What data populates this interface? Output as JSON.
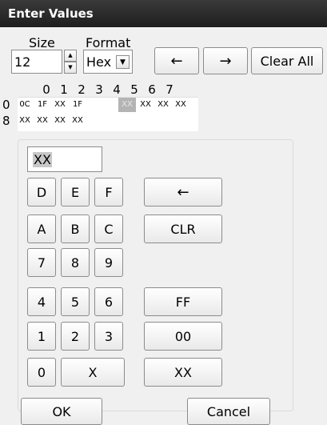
{
  "window": {
    "title": "Enter Values"
  },
  "controls": {
    "size_label": "Size",
    "size_value": "12",
    "format_label": "Format",
    "format_value": "Hex",
    "left_arrow": "←",
    "right_arrow": "→",
    "clear_all": "Clear All"
  },
  "grid": {
    "col_headers": [
      "0",
      "1",
      "2",
      "3",
      "4",
      "5",
      "6",
      "7"
    ],
    "row_headers": [
      "0",
      "8"
    ],
    "row0": [
      "0C",
      "1F",
      "XX",
      "1F",
      "XX",
      "XX",
      "XX",
      "XX"
    ],
    "row1": [
      "XX",
      "XX",
      "XX",
      "XX"
    ],
    "selected_cell": "row0.4"
  },
  "keypad": {
    "display_value": "XX",
    "digits": {
      "d": "D",
      "e": "E",
      "f": "F",
      "a": "A",
      "b": "B",
      "c": "C",
      "n7": "7",
      "n8": "8",
      "n9": "9",
      "n4": "4",
      "n5": "5",
      "n6": "6",
      "n1": "1",
      "n2": "2",
      "n3": "3",
      "n0": "0",
      "x": "X"
    },
    "backspace": "←",
    "clr": "CLR",
    "ff": "FF",
    "zero_zero": "00",
    "xx": "XX"
  },
  "footer": {
    "ok": "OK",
    "cancel": "Cancel"
  },
  "icons": {
    "spin_up": "▲",
    "spin_down": "▼",
    "dropdown": "▼"
  },
  "colors": {
    "titlebar": "#2a2a2a",
    "selected_cell": "#b4b4b4"
  }
}
